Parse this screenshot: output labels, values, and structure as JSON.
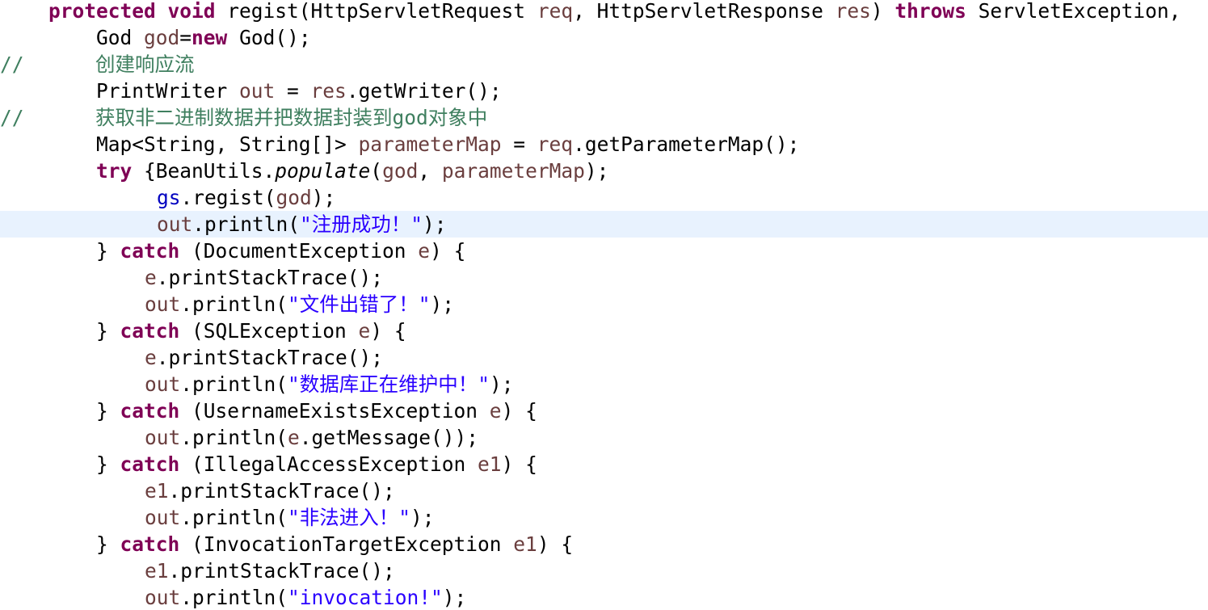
{
  "colors": {
    "keyword": "#7f0055",
    "variable": "#6a3e3e",
    "field": "#0000c0",
    "string": "#2a00ff",
    "comment": "#3f7f5f",
    "plain": "#000000",
    "current_line": "#e8f2fe"
  },
  "code": {
    "lines": [
      {
        "indent": 60,
        "tokens": [
          {
            "t": "protected",
            "k": "kw"
          },
          {
            "t": " ",
            "k": "plain"
          },
          {
            "t": "void",
            "k": "kw"
          },
          {
            "t": " regist(HttpServletRequest ",
            "k": "plain"
          },
          {
            "t": "req",
            "k": "var"
          },
          {
            "t": ", HttpServletResponse ",
            "k": "plain"
          },
          {
            "t": "res",
            "k": "var"
          },
          {
            "t": ") ",
            "k": "plain"
          },
          {
            "t": "throws",
            "k": "kw"
          },
          {
            "t": " ServletException,",
            "k": "plain"
          }
        ]
      },
      {
        "indent": 119,
        "tokens": [
          {
            "t": "God ",
            "k": "plain"
          },
          {
            "t": "god",
            "k": "var"
          },
          {
            "t": "=",
            "k": "plain"
          },
          {
            "t": "new",
            "k": "kw"
          },
          {
            "t": " God();",
            "k": "plain"
          }
        ]
      },
      {
        "indent": 0,
        "tokens": [
          {
            "t": "//      创建响应流",
            "k": "comment"
          }
        ]
      },
      {
        "indent": 119,
        "tokens": [
          {
            "t": "PrintWriter ",
            "k": "plain"
          },
          {
            "t": "out",
            "k": "var"
          },
          {
            "t": " = ",
            "k": "plain"
          },
          {
            "t": "res",
            "k": "var"
          },
          {
            "t": ".getWriter();",
            "k": "plain"
          }
        ]
      },
      {
        "indent": 0,
        "tokens": [
          {
            "t": "//      获取非二进制数据并把数据封装到god对象中",
            "k": "comment"
          }
        ]
      },
      {
        "indent": 119,
        "tokens": [
          {
            "t": "Map<String, String[]> ",
            "k": "plain"
          },
          {
            "t": "parameterMap",
            "k": "var"
          },
          {
            "t": " = ",
            "k": "plain"
          },
          {
            "t": "req",
            "k": "var"
          },
          {
            "t": ".getParameterMap();",
            "k": "plain"
          }
        ]
      },
      {
        "indent": 119,
        "tokens": [
          {
            "t": "try",
            "k": "kw"
          },
          {
            "t": " {BeanUtils.",
            "k": "plain"
          },
          {
            "t": "populate",
            "k": "italic"
          },
          {
            "t": "(",
            "k": "plain"
          },
          {
            "t": "god",
            "k": "var"
          },
          {
            "t": ", ",
            "k": "plain"
          },
          {
            "t": "parameterMap",
            "k": "var"
          },
          {
            "t": ");",
            "k": "plain"
          }
        ]
      },
      {
        "indent": 194,
        "tokens": [
          {
            "t": "gs",
            "k": "field"
          },
          {
            "t": ".regist(",
            "k": "plain"
          },
          {
            "t": "god",
            "k": "var"
          },
          {
            "t": ");",
            "k": "plain"
          }
        ]
      },
      {
        "indent": 194,
        "current": true,
        "tokens": [
          {
            "t": "out",
            "k": "var"
          },
          {
            "t": ".println(",
            "k": "plain"
          },
          {
            "t": "\"注册成功！\"",
            "k": "str"
          },
          {
            "t": ");",
            "k": "plain"
          }
        ]
      },
      {
        "indent": 119,
        "tokens": [
          {
            "t": "} ",
            "k": "plain"
          },
          {
            "t": "catch",
            "k": "kw"
          },
          {
            "t": " (DocumentException ",
            "k": "plain"
          },
          {
            "t": "e",
            "k": "var"
          },
          {
            "t": ") {",
            "k": "plain"
          }
        ]
      },
      {
        "indent": 179,
        "tokens": [
          {
            "t": "e",
            "k": "var"
          },
          {
            "t": ".printStackTrace();",
            "k": "plain"
          }
        ]
      },
      {
        "indent": 179,
        "tokens": [
          {
            "t": "out",
            "k": "var"
          },
          {
            "t": ".println(",
            "k": "plain"
          },
          {
            "t": "\"文件出错了！\"",
            "k": "str"
          },
          {
            "t": ");",
            "k": "plain"
          }
        ]
      },
      {
        "indent": 119,
        "tokens": [
          {
            "t": "} ",
            "k": "plain"
          },
          {
            "t": "catch",
            "k": "kw"
          },
          {
            "t": " (SQLException ",
            "k": "plain"
          },
          {
            "t": "e",
            "k": "var"
          },
          {
            "t": ") {",
            "k": "plain"
          }
        ]
      },
      {
        "indent": 179,
        "tokens": [
          {
            "t": "e",
            "k": "var"
          },
          {
            "t": ".printStackTrace();",
            "k": "plain"
          }
        ]
      },
      {
        "indent": 179,
        "tokens": [
          {
            "t": "out",
            "k": "var"
          },
          {
            "t": ".println(",
            "k": "plain"
          },
          {
            "t": "\"数据库正在维护中！\"",
            "k": "str"
          },
          {
            "t": ");",
            "k": "plain"
          }
        ]
      },
      {
        "indent": 119,
        "tokens": [
          {
            "t": "} ",
            "k": "plain"
          },
          {
            "t": "catch",
            "k": "kw"
          },
          {
            "t": " (UsernameExistsException ",
            "k": "plain"
          },
          {
            "t": "e",
            "k": "var"
          },
          {
            "t": ") {",
            "k": "plain"
          }
        ]
      },
      {
        "indent": 179,
        "tokens": [
          {
            "t": "out",
            "k": "var"
          },
          {
            "t": ".println(",
            "k": "plain"
          },
          {
            "t": "e",
            "k": "var"
          },
          {
            "t": ".getMessage());",
            "k": "plain"
          }
        ]
      },
      {
        "indent": 119,
        "tokens": [
          {
            "t": "} ",
            "k": "plain"
          },
          {
            "t": "catch",
            "k": "kw"
          },
          {
            "t": " (IllegalAccessException ",
            "k": "plain"
          },
          {
            "t": "e1",
            "k": "var"
          },
          {
            "t": ") {",
            "k": "plain"
          }
        ]
      },
      {
        "indent": 179,
        "tokens": [
          {
            "t": "e1",
            "k": "var"
          },
          {
            "t": ".printStackTrace();",
            "k": "plain"
          }
        ]
      },
      {
        "indent": 179,
        "tokens": [
          {
            "t": "out",
            "k": "var"
          },
          {
            "t": ".println(",
            "k": "plain"
          },
          {
            "t": "\"非法进入！\"",
            "k": "str"
          },
          {
            "t": ");",
            "k": "plain"
          }
        ]
      },
      {
        "indent": 119,
        "tokens": [
          {
            "t": "} ",
            "k": "plain"
          },
          {
            "t": "catch",
            "k": "kw"
          },
          {
            "t": " (InvocationTargetException ",
            "k": "plain"
          },
          {
            "t": "e1",
            "k": "var"
          },
          {
            "t": ") {",
            "k": "plain"
          }
        ]
      },
      {
        "indent": 179,
        "tokens": [
          {
            "t": "e1",
            "k": "var"
          },
          {
            "t": ".printStackTrace();",
            "k": "plain"
          }
        ]
      },
      {
        "indent": 179,
        "tokens": [
          {
            "t": "out",
            "k": "var"
          },
          {
            "t": ".println(",
            "k": "plain"
          },
          {
            "t": "\"invocation!\"",
            "k": "str"
          },
          {
            "t": ");",
            "k": "plain"
          }
        ]
      }
    ]
  }
}
